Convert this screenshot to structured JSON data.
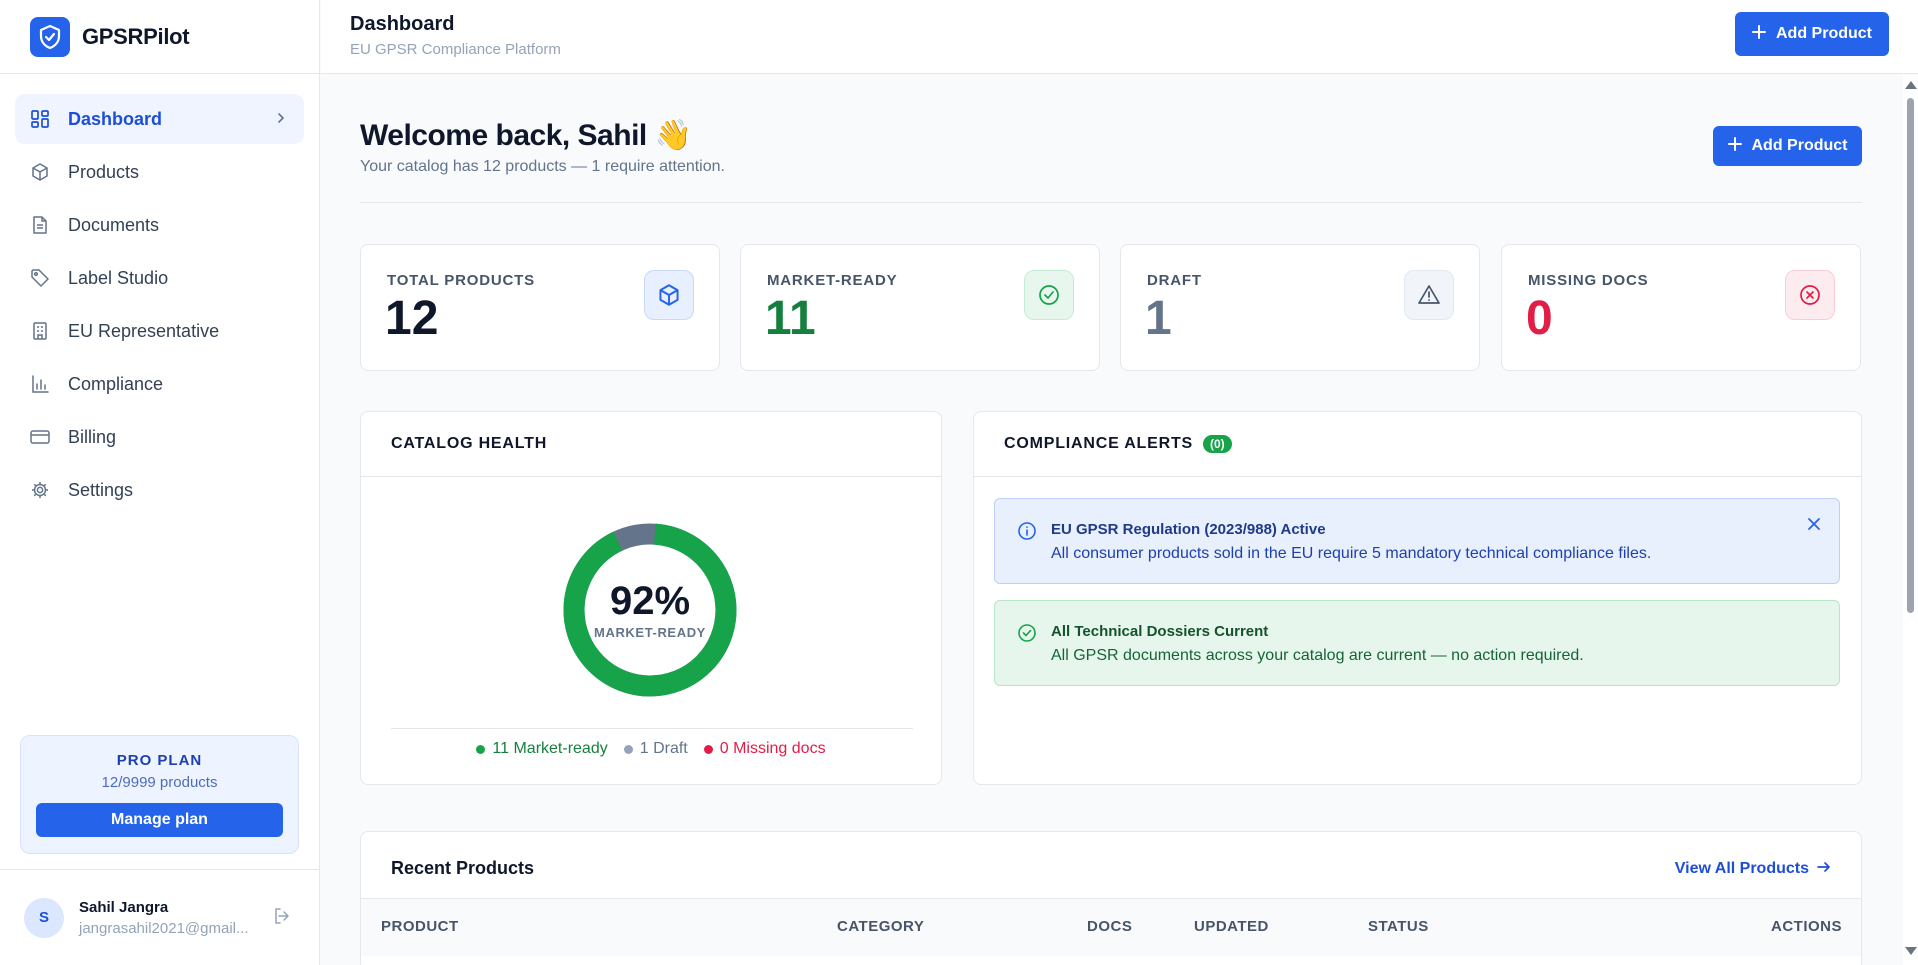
{
  "brand": {
    "name": "GPSRPilot"
  },
  "sidebar": {
    "items": [
      {
        "label": "Dashboard",
        "icon": "dashboard-icon",
        "active": true
      },
      {
        "label": "Products",
        "icon": "package-icon"
      },
      {
        "label": "Documents",
        "icon": "document-icon"
      },
      {
        "label": "Label Studio",
        "icon": "tag-icon"
      },
      {
        "label": "EU Representative",
        "icon": "building-icon"
      },
      {
        "label": "Compliance",
        "icon": "bar-chart-icon"
      },
      {
        "label": "Billing",
        "icon": "credit-card-icon"
      },
      {
        "label": "Settings",
        "icon": "gear-icon"
      }
    ],
    "plan": {
      "title": "PRO PLAN",
      "usage": "12/9999 products",
      "button": "Manage plan"
    },
    "user": {
      "initial": "S",
      "name": "Sahil Jangra",
      "email": "jangrasahil2021@gmail..."
    }
  },
  "topbar": {
    "title": "Dashboard",
    "subtitle": "EU GPSR Compliance Platform",
    "add_label": "Add Product"
  },
  "welcome": {
    "title": "Welcome back, Sahil 👋",
    "subtitle": "Your catalog has 12 products — 1 require attention.",
    "add_label": "Add Product"
  },
  "stats": [
    {
      "label": "TOTAL PRODUCTS",
      "value": "12",
      "color": "#0f172a",
      "icon": "package-icon"
    },
    {
      "label": "MARKET-READY",
      "value": "11",
      "color": "#15803d",
      "icon": "check-circle-icon"
    },
    {
      "label": "DRAFT",
      "value": "1",
      "color": "#64748b",
      "icon": "warning-icon"
    },
    {
      "label": "MISSING DOCS",
      "value": "0",
      "color": "#e11d48",
      "icon": "x-circle-icon"
    }
  ],
  "catalog_health": {
    "title": "CATALOG HEALTH",
    "percent": "92%",
    "center_label": "MARKET-READY",
    "ready_fraction": 0.92,
    "legend": [
      {
        "label": "11 Market-ready",
        "color": "#16a34a",
        "text_color": "#15803d"
      },
      {
        "label": "1 Draft",
        "color": "#94a3b8",
        "text_color": "#64748b"
      },
      {
        "label": "0 Missing docs",
        "color": "#e11d48",
        "text_color": "#e11d48"
      }
    ]
  },
  "alerts": {
    "title": "COMPLIANCE ALERTS",
    "count": "(0)",
    "items": [
      {
        "title": "EU GPSR Regulation (2023/988) Active",
        "text": "All consumer products sold in the EU require 5 mandatory technical compliance files."
      },
      {
        "title": "All Technical Dossiers Current",
        "text": "All GPSR documents across your catalog are current — no action required."
      }
    ]
  },
  "recent": {
    "title": "Recent Products",
    "view_all": "View All Products",
    "columns": [
      "PRODUCT",
      "CATEGORY",
      "DOCS",
      "UPDATED",
      "STATUS",
      "ACTIONS"
    ]
  }
}
